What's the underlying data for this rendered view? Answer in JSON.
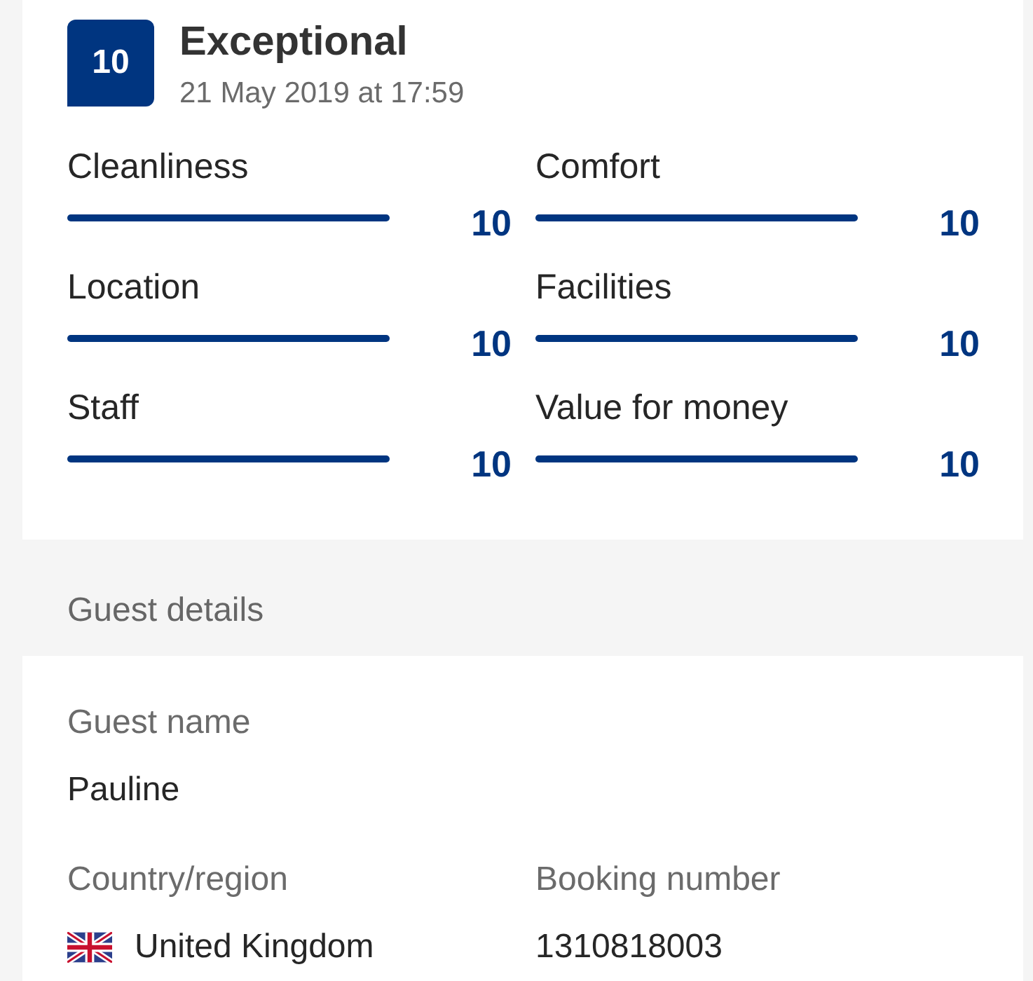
{
  "review": {
    "score": "10",
    "rating": "Exceptional",
    "date": "21 May 2019 at 17:59"
  },
  "categories": [
    {
      "label": "Cleanliness",
      "level": 1,
      "score": "10"
    },
    {
      "label": "Comfort",
      "level": 1,
      "score": "10"
    },
    {
      "label": "Location",
      "level": 1,
      "score": "10"
    },
    {
      "label": "Facilities",
      "level": 1,
      "score": "10"
    },
    {
      "label": "Staff",
      "level": 1,
      "score": "10"
    },
    {
      "label": "Value for money",
      "level": 1,
      "score": "10"
    }
  ],
  "section_title": "Guest details",
  "guest": {
    "name_label": "Guest name",
    "name": "Pauline",
    "country_label": "Country/region",
    "country": "United Kingdom",
    "booking_label": "Booking number",
    "booking_number": "1310818003"
  }
}
